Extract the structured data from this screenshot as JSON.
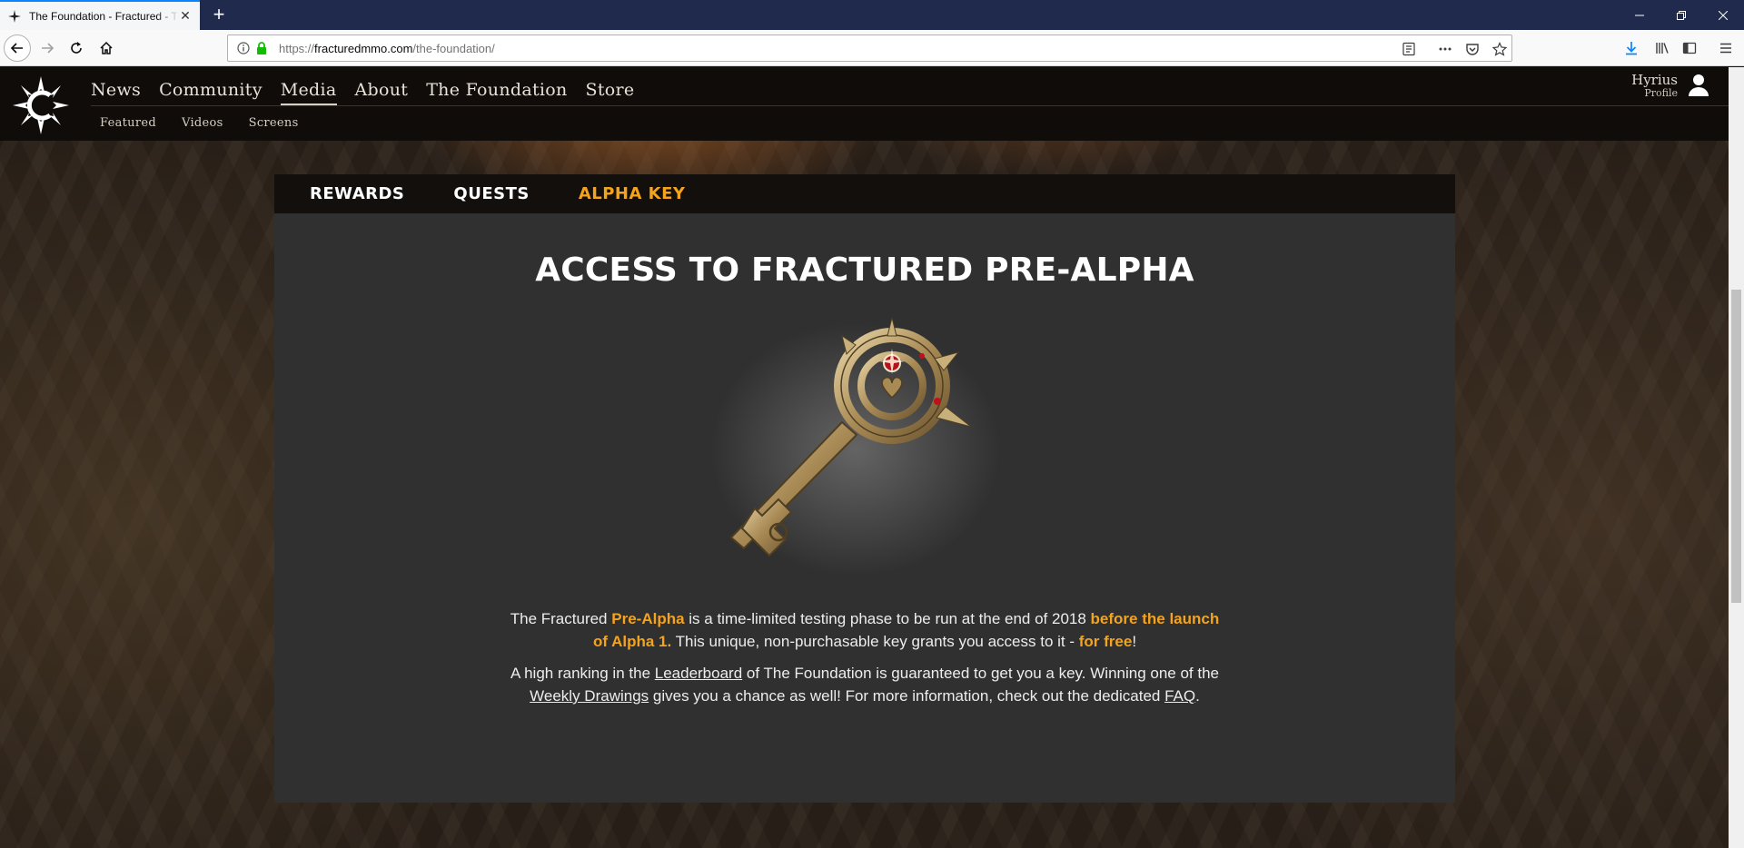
{
  "browser": {
    "tab_title": "The Foundation - Fractured - The",
    "url_scheme": "https://",
    "url_host": "fracturedmmo.com",
    "url_path": "/the-foundation/",
    "accent_color": "#0a84ff",
    "icons": [
      "back-icon",
      "forward-icon",
      "reload-icon",
      "home-icon",
      "info-icon",
      "lock-icon",
      "reader-view-icon",
      "page-actions-icon",
      "pocket-icon",
      "bookmark-star-icon",
      "download-icon",
      "library-icon",
      "sidebar-icon",
      "menu-icon",
      "minimize-icon",
      "restore-icon",
      "close-icon"
    ]
  },
  "site": {
    "nav": [
      "News",
      "Community",
      "Media",
      "About",
      "The Foundation",
      "Store"
    ],
    "active_nav": "Media",
    "subnav": [
      "Featured",
      "Videos",
      "Screens"
    ],
    "user": {
      "name": "Hyrius",
      "profile_label": "Profile"
    }
  },
  "panel": {
    "tabs": [
      "REWARDS",
      "QUESTS",
      "ALPHA KEY"
    ],
    "active_tab": "ALPHA KEY",
    "title": "ACCESS TO FRACTURED PRE-ALPHA",
    "highlight_color": "#f4a31c",
    "p1": {
      "t1": "The Fractured ",
      "h1": "Pre-Alpha",
      "t2": " is a time-limited testing phase to be run at the end of 2018 ",
      "h2": "before the launch of Alpha 1.",
      "t3": " This unique, non-purchasable key grants you access to it - ",
      "h3": "for free",
      "t4": "!"
    },
    "p2": {
      "t1": "A high ranking in the ",
      "l1": "Leaderboard",
      "t2": " of The Foundation is guaranteed to get you a key. Winning one of the ",
      "l2": "Weekly Drawings",
      "t3": " gives you a chance as well! For more information, check out the dedicated ",
      "l3": "FAQ",
      "t4": "."
    }
  }
}
